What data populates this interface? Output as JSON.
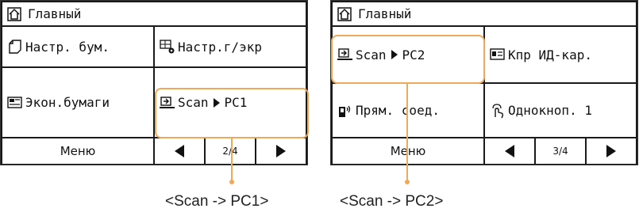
{
  "left_screen": {
    "title": "Главный",
    "buttons": {
      "paper_settings": "Настр. бум.",
      "display_settings": "Настр.г/экр",
      "paper_save": "Экон.бумаги",
      "scan_label": "Scan",
      "scan_target": "PC1"
    },
    "menu_label": "Меню",
    "page_indicator": "2/4"
  },
  "right_screen": {
    "title": "Главный",
    "buttons": {
      "scan_label": "Scan",
      "scan_target": "PC2",
      "id_card_copy": "Кпр ИД-кар.",
      "direct_connect": "Прям. соед.",
      "one_touch": "Однокноп. 1"
    },
    "menu_label": "Меню",
    "page_indicator": "3/4"
  },
  "captions": {
    "left": "<Scan -> PC1>",
    "right": "<Scan -> PC2>"
  },
  "colors": {
    "highlight": "#f0a85a",
    "screen_bg": "#1a1a1a"
  }
}
